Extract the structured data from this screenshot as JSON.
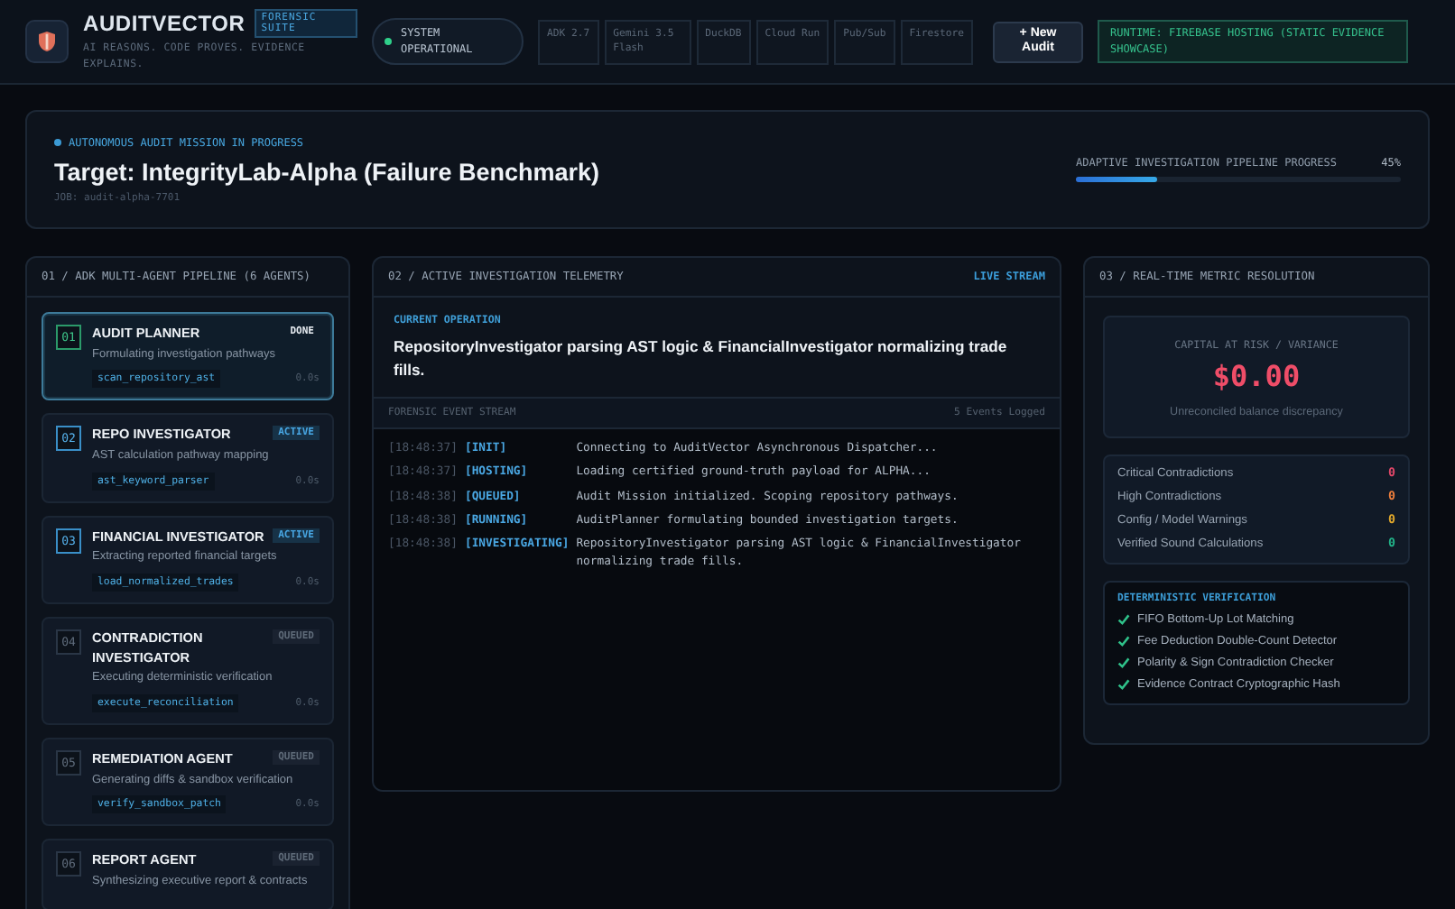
{
  "header": {
    "brand": "AUDITVECTOR",
    "badge": "FORENSIC SUITE",
    "tagline": "AI REASONS. CODE PROVES. EVIDENCE EXPLAINS.",
    "status": {
      "label": "SYSTEM OPERATIONAL",
      "on": true
    },
    "tech": [
      "ADK 2.7",
      "Gemini 3.5 Flash",
      "DuckDB",
      "Cloud Run",
      "Pub/Sub",
      "Firestore"
    ],
    "new_button": "+ New Audit",
    "runtime": "RUNTIME: FIREBASE HOSTING (STATIC EVIDENCE SHOWCASE)"
  },
  "mission": {
    "status": "AUTONOMOUS AUDIT MISSION IN PROGRESS",
    "title": "Target: IntegrityLab-Alpha (Failure Benchmark)",
    "job": "JOB: audit-alpha-7701",
    "progress_label": "ADAPTIVE INVESTIGATION PIPELINE PROGRESS",
    "progress_value": "45%",
    "level": 0.25
  },
  "pipeline": {
    "title": "01 / ADK MULTI-AGENT PIPELINE (6 AGENTS)",
    "agents": [
      {
        "number": "01",
        "name": "AUDIT PLANNER",
        "status": "DONE",
        "kind": "done",
        "selected": true,
        "description": "Formulating investigation pathways",
        "tool": "scan_repository_ast",
        "time": "0.0s"
      },
      {
        "number": "02",
        "name": "REPO INVESTIGATOR",
        "status": "ACTIVE",
        "kind": "active",
        "selected": false,
        "description": "AST calculation pathway mapping",
        "tool": "ast_keyword_parser",
        "time": "0.0s"
      },
      {
        "number": "03",
        "name": "FINANCIAL INVESTIGATOR",
        "status": "ACTIVE",
        "kind": "active",
        "selected": false,
        "description": "Extracting reported financial targets",
        "tool": "load_normalized_trades",
        "time": "0.0s"
      },
      {
        "number": "04",
        "name": "CONTRADICTION INVESTIGATOR",
        "status": "QUEUED",
        "kind": "queued",
        "selected": false,
        "description": "Executing deterministic verification",
        "tool": "execute_reconciliation",
        "time": "0.0s"
      },
      {
        "number": "05",
        "name": "REMEDIATION AGENT",
        "status": "QUEUED",
        "kind": "queued",
        "selected": false,
        "description": "Generating diffs & sandbox verification",
        "tool": "verify_sandbox_patch",
        "time": "0.0s"
      },
      {
        "number": "06",
        "name": "REPORT AGENT",
        "status": "QUEUED",
        "kind": "queued",
        "selected": false,
        "description": "Synthesizing executive report & contracts"
      }
    ]
  },
  "telemetry": {
    "title": "02 / ACTIVE INVESTIGATION TELEMETRY",
    "live": "LIVE STREAM",
    "operation_label": "CURRENT OPERATION",
    "operation": "RepositoryInvestigator parsing AST logic & FinancialInvestigator normalizing trade fills.",
    "stream_title": "FORENSIC EVENT STREAM",
    "events_count": "5 Events Logged",
    "events": [
      {
        "time": "[18:48:37]",
        "tag": "[INIT]",
        "message": "Connecting to AuditVector Asynchronous Dispatcher..."
      },
      {
        "time": "[18:48:37]",
        "tag": "[HOSTING]",
        "message": "Loading certified ground-truth payload for ALPHA..."
      },
      {
        "time": "[18:48:38]",
        "tag": "[QUEUED]",
        "message": "Audit Mission initialized. Scoping repository pathways."
      },
      {
        "time": "[18:48:38]",
        "tag": "[RUNNING]",
        "message": "AuditPlanner formulating bounded investigation targets."
      },
      {
        "time": "[18:48:38]",
        "tag": "[INVESTIGATING]",
        "message": "RepositoryInvestigator parsing AST logic & FinancialInvestigator normalizing trade fills."
      }
    ]
  },
  "metrics": {
    "title": "03 / REAL-TIME METRIC RESOLUTION",
    "capital_label": "CAPITAL AT RISK / VARIANCE",
    "capital_value": "$0.00",
    "capital_note": "Unreconciled balance discrepancy",
    "counts": [
      {
        "label": "Critical Contradictions",
        "value": "0",
        "color": "#e5486a"
      },
      {
        "label": "High Contradictions",
        "value": "0",
        "color": "#f07f3c"
      },
      {
        "label": "Config / Model Warnings",
        "value": "0",
        "color": "#e3a92b"
      },
      {
        "label": "Verified Sound Calculations",
        "value": "0",
        "color": "#22b58a"
      }
    ],
    "verification_title": "DETERMINISTIC VERIFICATION",
    "checks": [
      {
        "label": "FIFO Bottom-Up Lot Matching",
        "checked": true
      },
      {
        "label": "Fee Deduction Double-Count Detector",
        "checked": true
      },
      {
        "label": "Polarity & Sign Contradiction Checker",
        "checked": true
      },
      {
        "label": "Evidence Contract Cryptographic Hash",
        "checked": true
      }
    ]
  }
}
